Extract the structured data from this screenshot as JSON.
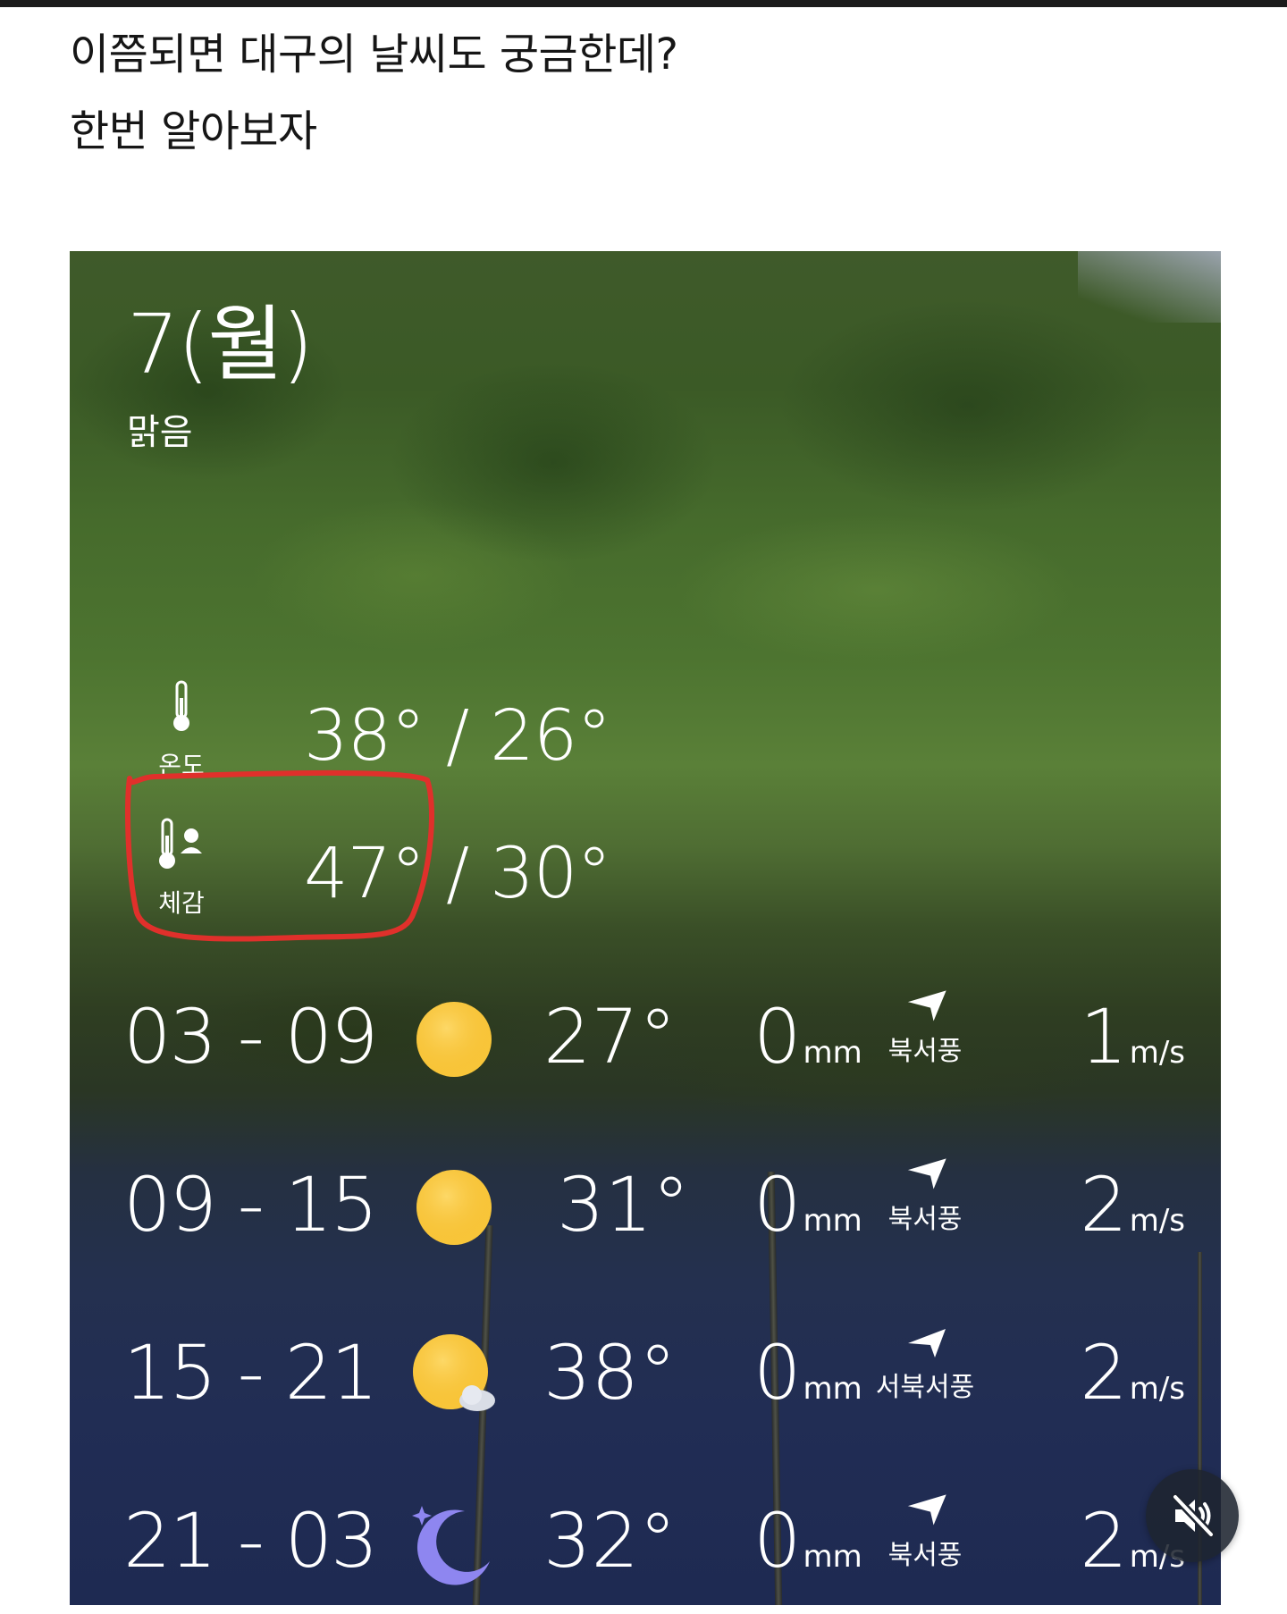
{
  "post": {
    "line1": "이쯤되면 대구의 날씨도 궁금한데?",
    "line2": "한번 알아보자"
  },
  "weather": {
    "date_title": "7(월)",
    "condition": "맑음",
    "temperature": {
      "label": "온도",
      "value": "38° / 26°",
      "icon": "thermometer-icon"
    },
    "feels_like": {
      "label": "체감",
      "value": "47° / 30°",
      "icon": "thermometer-person-icon",
      "highlight_color": "#e0302b"
    },
    "forecast": [
      {
        "time": "03 - 09",
        "icon": "sun-icon",
        "temp": "27°",
        "rain": "0",
        "rain_unit": "mm",
        "wind_dir": "북서풍",
        "wind_speed": "1",
        "wind_unit": "m/s"
      },
      {
        "time": "09 - 15",
        "icon": "sun-icon",
        "temp": "31°",
        "rain": "0",
        "rain_unit": "mm",
        "wind_dir": "북서풍",
        "wind_speed": "2",
        "wind_unit": "m/s"
      },
      {
        "time": "15 - 21",
        "icon": "sun-cloud-icon",
        "temp": "38°",
        "rain": "0",
        "rain_unit": "mm",
        "wind_dir": "서북서풍",
        "wind_speed": "2",
        "wind_unit": "m/s"
      },
      {
        "time": "21 - 03",
        "icon": "moon-icon",
        "temp": "32°",
        "rain": "0",
        "rain_unit": "mm",
        "wind_dir": "북서풍",
        "wind_speed": "2",
        "wind_unit": "m/s"
      }
    ]
  },
  "colors": {
    "sun": "#f8c63a",
    "moon": "#8e86f0",
    "highlight": "#e0302b"
  },
  "controls": {
    "mute_icon": "speaker-muted-icon"
  }
}
